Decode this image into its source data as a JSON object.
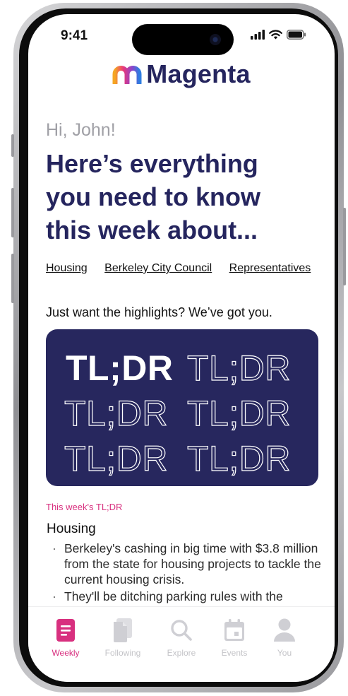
{
  "status_bar": {
    "time": "9:41"
  },
  "app": {
    "name": "Magenta"
  },
  "greeting": "Hi, John!",
  "headline": "Here’s everything you need to know this week about...",
  "topics": [
    "Housing",
    "Berkeley City Council",
    "Representatives"
  ],
  "highlights_label": "Just want the highlights? We’ve got you.",
  "tldr_card": {
    "word": "TL;DR",
    "background": "#27275e"
  },
  "this_week_label": "This week's TL;DR",
  "section": {
    "title": "Housing",
    "bullets": [
      "Berkeley's cashing in big time with $3.8 million from the state for housing projects to tackle the current housing crisis.",
      "They'll be ditching parking rules with the"
    ]
  },
  "tab_bar": {
    "tabs": [
      {
        "label": "Weekly",
        "icon": "weekly-document-icon",
        "active": true
      },
      {
        "label": "Following",
        "icon": "following-document-icon",
        "active": false
      },
      {
        "label": "Explore",
        "icon": "search-icon",
        "active": false
      },
      {
        "label": "Events",
        "icon": "calendar-icon",
        "active": false
      },
      {
        "label": "You",
        "icon": "person-icon",
        "active": false
      }
    ]
  },
  "colors": {
    "brand_navy": "#25255e",
    "accent_magenta": "#d8307f",
    "inactive_gray": "#c4c4c8"
  }
}
